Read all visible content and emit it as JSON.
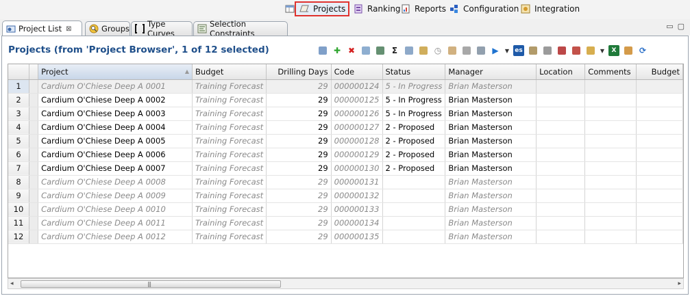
{
  "perspectives": [
    {
      "label": "",
      "icon": "perspective-switch-icon"
    },
    {
      "label": "Projects",
      "icon": "projects-icon",
      "active": true
    },
    {
      "label": "Ranking",
      "icon": "ranking-icon"
    },
    {
      "label": "Reports",
      "icon": "reports-icon"
    },
    {
      "label": "Configuration",
      "icon": "configuration-icon"
    },
    {
      "label": "Integration",
      "icon": "integration-icon"
    }
  ],
  "tabs": [
    {
      "label": "Project List",
      "icon": "project-list-icon",
      "active": true,
      "close": "⊠"
    },
    {
      "label": "Groups",
      "icon": "groups-icon"
    },
    {
      "label": "Type Curves",
      "icon": "type-curves-icon"
    },
    {
      "label": "Selection Constraints",
      "icon": "selection-constraints-icon"
    }
  ],
  "window_controls": {
    "minimize": "▭",
    "maximize": "▢"
  },
  "view": {
    "title": "Projects (from 'Project Browser', 1 of 12 selected)"
  },
  "toolbar_icons": [
    {
      "name": "refresh-projects-icon",
      "color": "#6a8fbf",
      "glyph": ""
    },
    {
      "name": "add-icon",
      "color": "#2fa52f",
      "glyph": "✚"
    },
    {
      "name": "delete-icon",
      "color": "#d42020",
      "glyph": "✖"
    },
    {
      "name": "copy-project-icon",
      "color": "#7aa0c8",
      "glyph": ""
    },
    {
      "name": "export-icon",
      "color": "#4a7c59",
      "glyph": ""
    },
    {
      "name": "sum-icon",
      "color": "#222222",
      "glyph": "Σ"
    },
    {
      "name": "merge-icon",
      "color": "#7a9abf",
      "glyph": ""
    },
    {
      "name": "edit-icon",
      "color": "#c8a040",
      "glyph": ""
    },
    {
      "name": "clock-icon",
      "color": "#888888",
      "glyph": "◷"
    },
    {
      "name": "grid-edit-icon",
      "color": "#c9a36a",
      "glyph": ""
    },
    {
      "name": "list-icon",
      "color": "#999999",
      "glyph": ""
    },
    {
      "name": "transfer-icon",
      "color": "#7f8fa0",
      "glyph": ""
    },
    {
      "name": "run-icon",
      "color": "#1f73d0",
      "glyph": "▶"
    },
    {
      "name": "run-dropdown-icon",
      "color": "#333333",
      "glyph": "▼",
      "dd": true
    },
    {
      "name": "es-icon",
      "color": "#1e5aa8",
      "glyph": "es"
    },
    {
      "name": "document-icon",
      "color": "#a48a50",
      "glyph": ""
    },
    {
      "name": "clipboard-icon",
      "color": "#8a8a8a",
      "glyph": ""
    },
    {
      "name": "network-icon",
      "color": "#b02828",
      "glyph": ""
    },
    {
      "name": "palette-icon",
      "color": "#b8342a",
      "glyph": ""
    },
    {
      "name": "settings-icon",
      "color": "#d0a030",
      "glyph": ""
    },
    {
      "name": "settings-dropdown-icon",
      "color": "#333333",
      "glyph": "▼",
      "dd": true
    },
    {
      "name": "excel-icon",
      "color": "#1f7a3a",
      "glyph": "X"
    },
    {
      "name": "table-icon",
      "color": "#cc8a2a",
      "glyph": ""
    },
    {
      "name": "sync-icon",
      "color": "#2a6fc8",
      "glyph": "⟳"
    }
  ],
  "table": {
    "columns": [
      "",
      "Project",
      "Budget",
      "Drilling Days",
      "Code",
      "Status",
      "Manager",
      "Location",
      "Comments",
      "Budget"
    ],
    "rows": [
      {
        "n": "1",
        "project": "Cardium O'Chiese Deep A 0001",
        "budget": "Training Forecast",
        "days": "29",
        "code": "000000124",
        "status": "5 - In Progress",
        "manager": "Brian Masterson",
        "active": false
      },
      {
        "n": "2",
        "project": "Cardium O'Chiese Deep A 0002",
        "budget": "Training Forecast",
        "days": "29",
        "code": "000000125",
        "status": "5 - In Progress",
        "manager": "Brian Masterson",
        "active": true
      },
      {
        "n": "3",
        "project": "Cardium O'Chiese Deep A 0003",
        "budget": "Training Forecast",
        "days": "29",
        "code": "000000126",
        "status": "5 - In Progress",
        "manager": "Brian Masterson",
        "active": true
      },
      {
        "n": "4",
        "project": "Cardium O'Chiese Deep A 0004",
        "budget": "Training Forecast",
        "days": "29",
        "code": "000000127",
        "status": "2 - Proposed",
        "manager": "Brian Masterson",
        "active": true
      },
      {
        "n": "5",
        "project": "Cardium O'Chiese Deep A 0005",
        "budget": "Training Forecast",
        "days": "29",
        "code": "000000128",
        "status": "2 - Proposed",
        "manager": "Brian Masterson",
        "active": true
      },
      {
        "n": "6",
        "project": "Cardium O'Chiese Deep A 0006",
        "budget": "Training Forecast",
        "days": "29",
        "code": "000000129",
        "status": "2 - Proposed",
        "manager": "Brian Masterson",
        "active": true
      },
      {
        "n": "7",
        "project": "Cardium O'Chiese Deep A 0007",
        "budget": "Training Forecast",
        "days": "29",
        "code": "000000130",
        "status": "2 - Proposed",
        "manager": "Brian Masterson",
        "active": true
      },
      {
        "n": "8",
        "project": "Cardium O'Chiese Deep A 0008",
        "budget": "Training Forecast",
        "days": "29",
        "code": "000000131",
        "status": "",
        "manager": "Brian Masterson",
        "active": false
      },
      {
        "n": "9",
        "project": "Cardium O'Chiese Deep A 0009",
        "budget": "Training Forecast",
        "days": "29",
        "code": "000000132",
        "status": "",
        "manager": "Brian Masterson",
        "active": false
      },
      {
        "n": "10",
        "project": "Cardium O'Chiese Deep A 0010",
        "budget": "Training Forecast",
        "days": "29",
        "code": "000000133",
        "status": "",
        "manager": "Brian Masterson",
        "active": false
      },
      {
        "n": "11",
        "project": "Cardium O'Chiese Deep A 0011",
        "budget": "Training Forecast",
        "days": "29",
        "code": "000000134",
        "status": "",
        "manager": "Brian Masterson",
        "active": false
      },
      {
        "n": "12",
        "project": "Cardium O'Chiese Deep A 0012",
        "budget": "Training Forecast",
        "days": "29",
        "code": "000000135",
        "status": "",
        "manager": "Brian Masterson",
        "active": false
      }
    ]
  },
  "scrollbar": {
    "left": "◂",
    "right": "▸",
    "grip": "|||"
  },
  "colors": {
    "accent": "#1f4f8a",
    "highlight_border": "#e0322e",
    "inactive_text": "#8a8a8a"
  }
}
